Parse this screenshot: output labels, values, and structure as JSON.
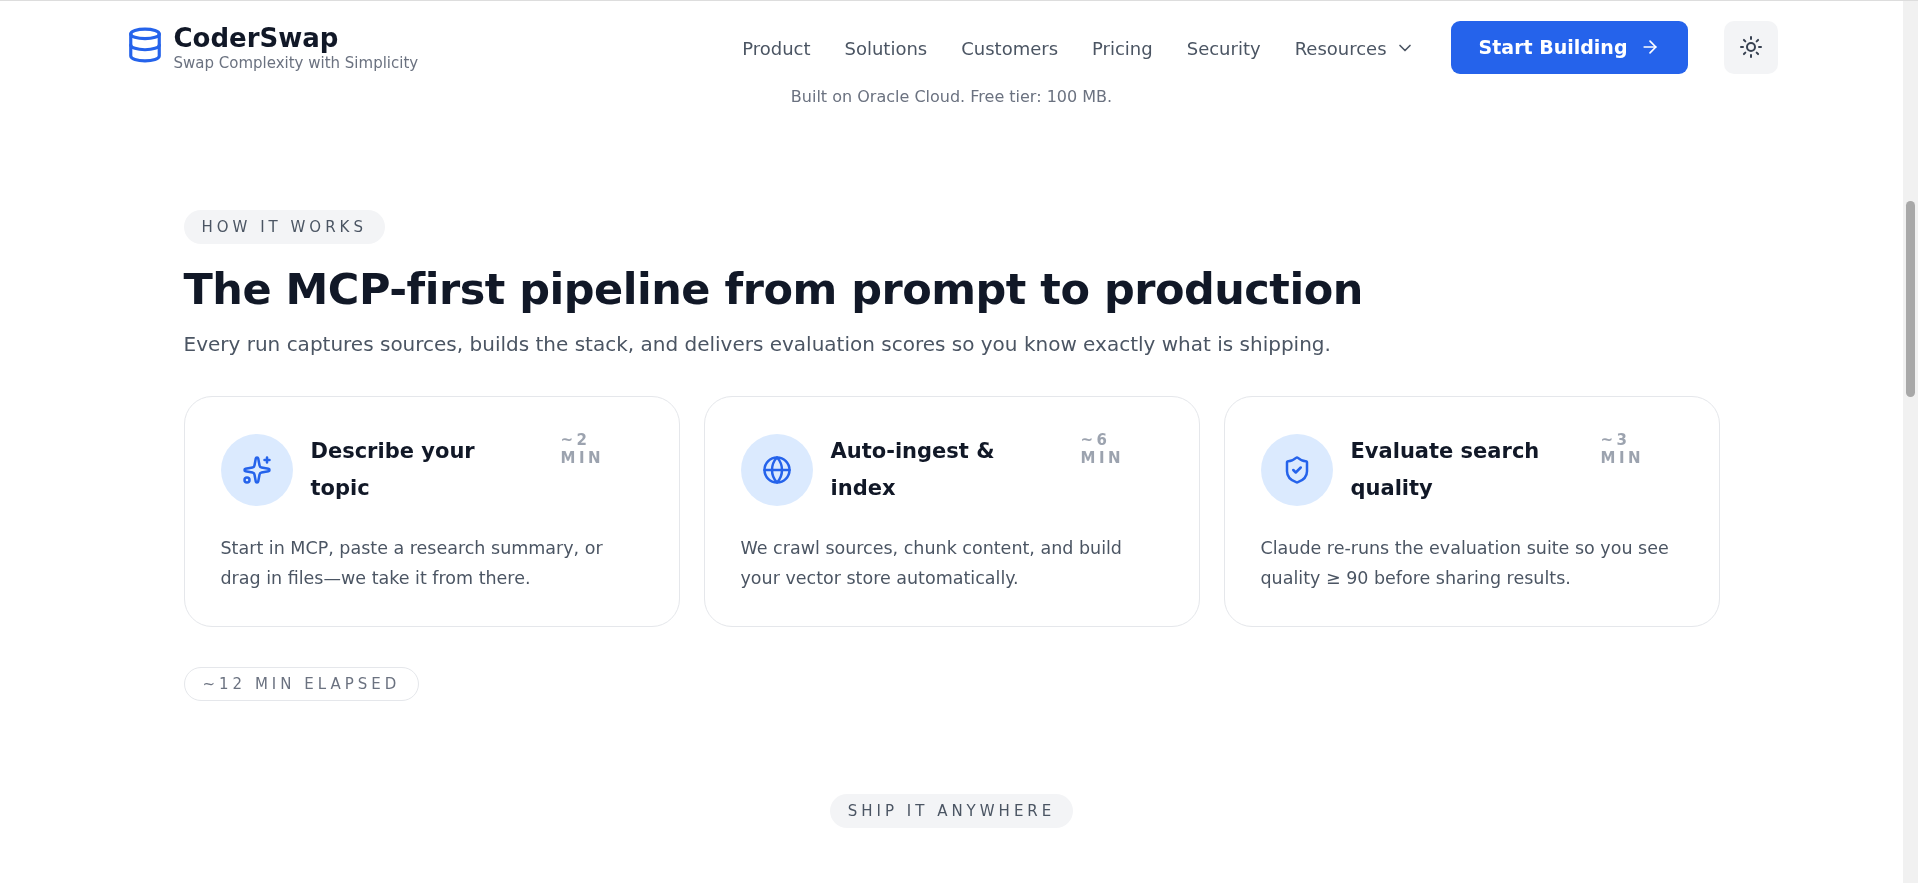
{
  "header": {
    "brand": {
      "name": "CoderSwap",
      "tagline": "Swap Complexity with Simplicity"
    },
    "nav": [
      {
        "label": "Product",
        "kind": "link"
      },
      {
        "label": "Solutions",
        "kind": "link"
      },
      {
        "label": "Customers",
        "kind": "link"
      },
      {
        "label": "Pricing",
        "kind": "link"
      },
      {
        "label": "Security",
        "kind": "link"
      },
      {
        "label": "Resources",
        "kind": "dropdown"
      }
    ],
    "cta": "Start Building"
  },
  "hero_note": "Built on Oracle Cloud. Free tier: 100 MB.",
  "how_it_works": {
    "eyebrow": "HOW IT WORKS",
    "title": "The MCP-first pipeline from prompt to production",
    "subtitle": "Every run captures sources, builds the stack, and delivers evaluation scores so you know exactly what is shipping.",
    "steps": [
      {
        "kind": "sparkles",
        "title": "Describe your topic",
        "duration": "~2 MIN",
        "text": "Start in MCP, paste a research summary, or drag in files—we take it from there."
      },
      {
        "kind": "globe",
        "title": "Auto-ingest & index",
        "duration": "~6 MIN",
        "text": "We crawl sources, chunk content, and build your vector store automatically."
      },
      {
        "kind": "shield",
        "title": "Evaluate search quality",
        "duration": "~3 MIN",
        "text": "Claude re-runs the evaluation suite so you see quality ≥ 90 before sharing results."
      }
    ],
    "elapsed": "~12 MIN ELAPSED"
  },
  "next_section": {
    "eyebrow": "SHIP IT ANYWHERE"
  }
}
